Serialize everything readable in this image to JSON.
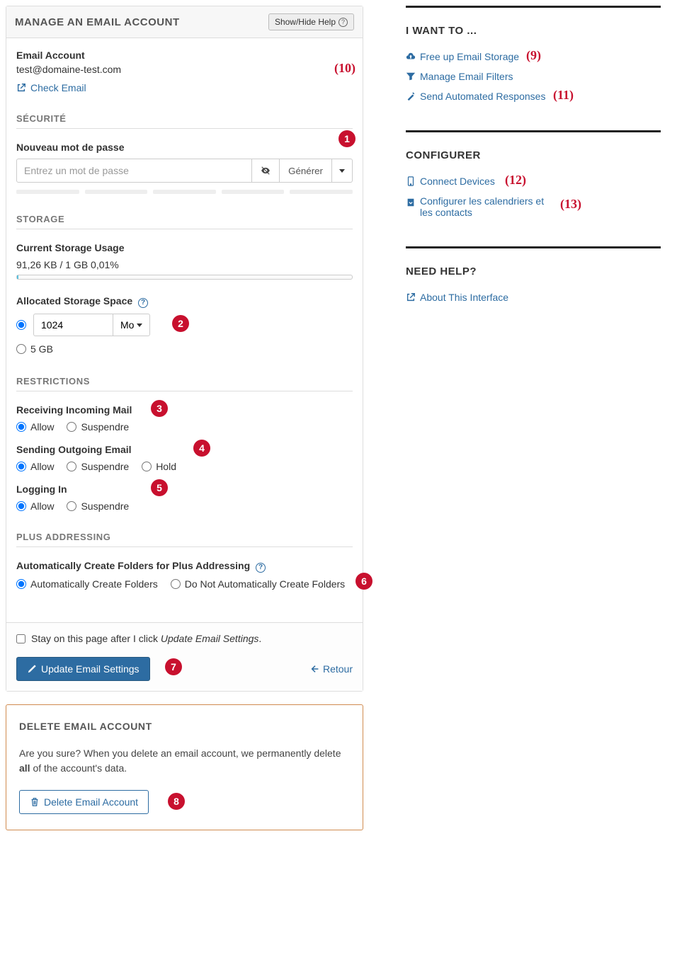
{
  "header": {
    "title": "MANAGE AN EMAIL ACCOUNT",
    "helpButton": "Show/Hide Help"
  },
  "account": {
    "label": "Email Account",
    "email": "test@domaine-test.com",
    "checkEmail": "Check Email"
  },
  "security": {
    "heading": "SÉCURITÉ",
    "passwordLabel": "Nouveau mot de passe",
    "placeholder": "Entrez un mot de passe",
    "generate": "Générer"
  },
  "storage": {
    "heading": "STORAGE",
    "usageLabel": "Current Storage Usage",
    "usageText": "91,26 KB / 1 GB 0,01%",
    "allocatedLabel": "Allocated Storage Space",
    "customValue": "1024",
    "unit": "Mo",
    "maxOption": "5 GB"
  },
  "restrictions": {
    "heading": "RESTRICTIONS",
    "incomingLabel": "Receiving Incoming Mail",
    "outgoingLabel": "Sending Outgoing Email",
    "loginLabel": "Logging In",
    "allow": "Allow",
    "suspend": "Suspendre",
    "hold": "Hold"
  },
  "plus": {
    "heading": "PLUS ADDRESSING",
    "label": "Automatically Create Folders for Plus Addressing",
    "yes": "Automatically Create Folders",
    "no": "Do Not Automatically Create Folders"
  },
  "footer": {
    "stayPrefix": "Stay on this page after I click ",
    "stayItalic": "Update Email Settings",
    "staySuffix": ".",
    "updateBtn": "Update Email Settings",
    "back": "Retour"
  },
  "deletePanel": {
    "heading": "DELETE EMAIL ACCOUNT",
    "textPrefix": "Are you sure? When you delete an email account, we permanently delete ",
    "textBold": "all",
    "textSuffix": " of the account's data.",
    "button": "Delete Email Account"
  },
  "sidebar": {
    "want": {
      "heading": "I WANT TO ...",
      "freeStorage": "Free up Email Storage",
      "filters": "Manage Email Filters",
      "auto": "Send Automated Responses"
    },
    "config": {
      "heading": "CONFIGURER",
      "connect": "Connect Devices",
      "calendar": "Configurer les calendriers et les contacts"
    },
    "help": {
      "heading": "NEED HELP?",
      "about": "About This Interface"
    }
  },
  "annotations": {
    "n1": "1",
    "n2": "2",
    "n3": "3",
    "n4": "4",
    "n5": "5",
    "n6": "6",
    "n7": "7",
    "n8": "8",
    "p9": "(9)",
    "p10": "(10)",
    "p11": "(11)",
    "p12": "(12)",
    "p13": "(13)"
  }
}
